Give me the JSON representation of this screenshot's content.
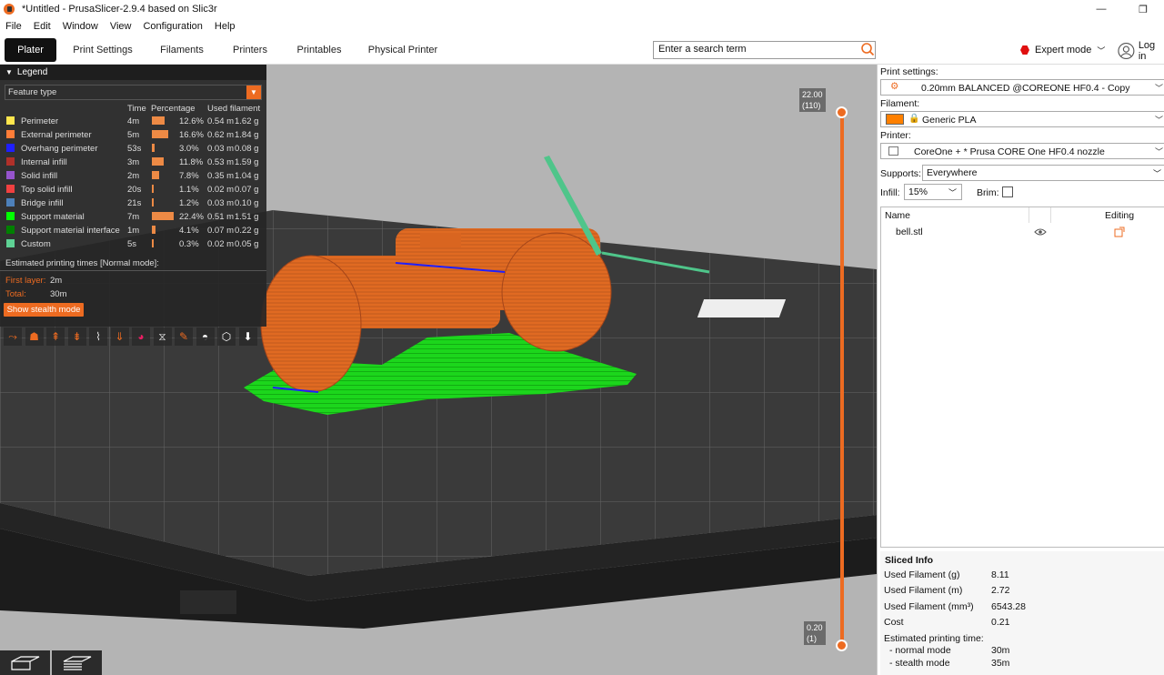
{
  "window": {
    "title": "*Untitled - PrusaSlicer-2.9.4 based on Slic3r",
    "minimize": "—",
    "maximize": "❐"
  },
  "menu": [
    "File",
    "Edit",
    "Window",
    "View",
    "Configuration",
    "Help"
  ],
  "tabs": [
    "Plater",
    "Print Settings",
    "Filaments",
    "Printers",
    "Printables",
    "Physical Printer"
  ],
  "search": {
    "placeholder": "Enter a search term"
  },
  "mode": {
    "label": "Expert mode",
    "color": "#e01010"
  },
  "login": {
    "label": "Log in"
  },
  "legend": {
    "title": "Legend",
    "view_type": "Feature type",
    "columns": {
      "time": "Time",
      "percentage": "Percentage",
      "used": "Used filament"
    },
    "items": [
      {
        "name": "Perimeter",
        "color": "#ffe64d",
        "time": "4m",
        "pct": "12.6%",
        "pct_value": 12.6,
        "len": "0.54 m",
        "weight": "1.62 g"
      },
      {
        "name": "External perimeter",
        "color": "#ff7d38",
        "time": "5m",
        "pct": "16.6%",
        "pct_value": 16.6,
        "len": "0.62 m",
        "weight": "1.84 g"
      },
      {
        "name": "Overhang perimeter",
        "color": "#1f1fff",
        "time": "53s",
        "pct": "3.0%",
        "pct_value": 3.0,
        "len": "0.03 m",
        "weight": "0.08 g"
      },
      {
        "name": "Internal infill",
        "color": "#b03029",
        "time": "3m",
        "pct": "11.8%",
        "pct_value": 11.8,
        "len": "0.53 m",
        "weight": "1.59 g"
      },
      {
        "name": "Solid infill",
        "color": "#9654cc",
        "time": "2m",
        "pct": "7.8%",
        "pct_value": 7.8,
        "len": "0.35 m",
        "weight": "1.04 g"
      },
      {
        "name": "Top solid infill",
        "color": "#f04040",
        "time": "20s",
        "pct": "1.1%",
        "pct_value": 1.1,
        "len": "0.02 m",
        "weight": "0.07 g"
      },
      {
        "name": "Bridge infill",
        "color": "#4d80ba",
        "time": "21s",
        "pct": "1.2%",
        "pct_value": 1.2,
        "len": "0.03 m",
        "weight": "0.10 g"
      },
      {
        "name": "Support material",
        "color": "#00ff00",
        "time": "7m",
        "pct": "22.4%",
        "pct_value": 22.4,
        "len": "0.51 m",
        "weight": "1.51 g"
      },
      {
        "name": "Support material interface",
        "color": "#008000",
        "time": "1m",
        "pct": "4.1%",
        "pct_value": 4.1,
        "len": "0.07 m",
        "weight": "0.22 g"
      },
      {
        "name": "Custom",
        "color": "#5ed194",
        "time": "5s",
        "pct": "0.3%",
        "pct_value": 0.3,
        "len": "0.02 m",
        "weight": "0.05 g"
      }
    ],
    "estimated_title": "Estimated printing times [Normal mode]:",
    "first_layer_label": "First layer:",
    "first_layer_value": "2m",
    "total_label": "Total:",
    "total_value": "30m",
    "stealth_button": "Show stealth mode"
  },
  "layer_slider": {
    "top_height": "22.00",
    "top_layer": "(110)",
    "bottom_height": "0.20",
    "bottom_layer": "(1)"
  },
  "right_panel": {
    "print_settings_label": "Print settings:",
    "print_settings_value": "0.20mm BALANCED @COREONE HF0.4 - Copy",
    "filament_label": "Filament:",
    "filament_value": "Generic PLA",
    "filament_color": "#ff8000",
    "printer_label": "Printer:",
    "printer_value": "CoreOne + * Prusa CORE One HF0.4 nozzle",
    "supports_label": "Supports:",
    "supports_value": "Everywhere",
    "infill_label": "Infill:",
    "infill_value": "15%",
    "brim_label": "Brim:",
    "list_col_name": "Name",
    "list_col_editing": "Editing",
    "objects": [
      "bell.stl"
    ]
  },
  "sliced_info": {
    "title": "Sliced Info",
    "rows": [
      {
        "label": "Used Filament (g)",
        "value": "8.11"
      },
      {
        "label": "Used Filament (m)",
        "value": "2.72"
      },
      {
        "label": "Used Filament (mm³)",
        "value": "6543.28"
      },
      {
        "label": "Cost",
        "value": "0.21"
      }
    ],
    "est_label": "Estimated printing time:",
    "normal_label": "- normal mode",
    "normal_value": "30m",
    "stealth_label": "- stealth mode",
    "stealth_value": "35m"
  }
}
